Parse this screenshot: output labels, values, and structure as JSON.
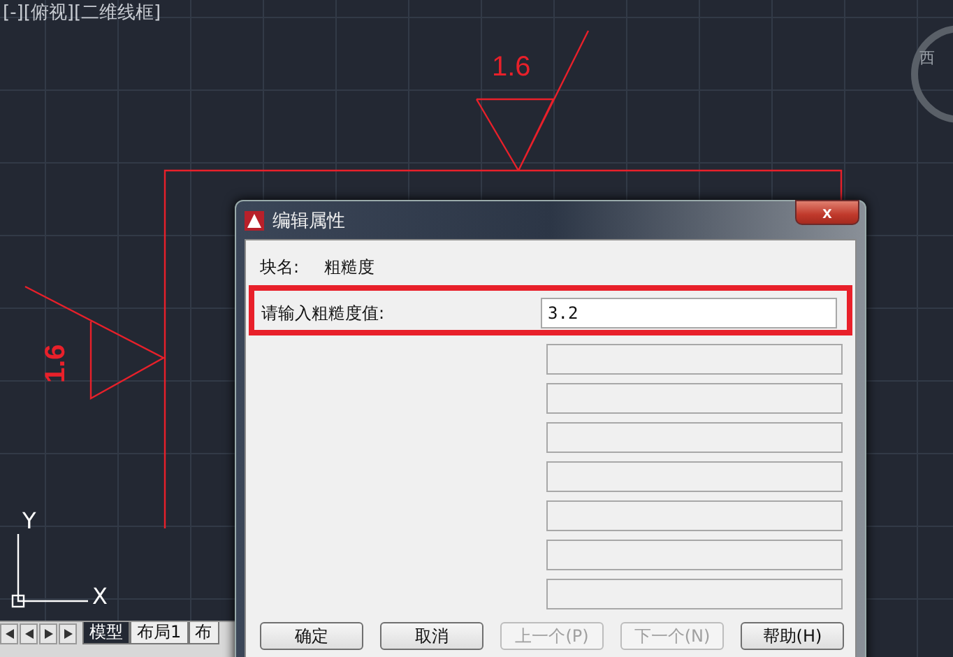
{
  "viewport_label": "[-][俯视][二维线框]",
  "compass_label": "西",
  "drawing": {
    "top_symbol_value": "1.6",
    "side_symbol_value": "1.6",
    "ucs_y": "Y",
    "ucs_x": "X"
  },
  "layout_tabs": [
    {
      "label": "模型",
      "selected": true
    },
    {
      "label": "布局1",
      "selected": false
    },
    {
      "label": "布",
      "selected": false
    }
  ],
  "dialog": {
    "title": "编辑属性",
    "close": "x",
    "block_name_label": "块名:",
    "block_name_value": "粗糙度",
    "fields": [
      {
        "label": "请输入粗糙度值:",
        "value": "3.2",
        "disabled": false,
        "highlighted": true
      },
      {
        "disabled": true,
        "highlighted": false
      },
      {
        "disabled": true,
        "highlighted": false
      },
      {
        "disabled": true,
        "highlighted": false
      },
      {
        "disabled": true,
        "highlighted": false
      },
      {
        "disabled": true,
        "highlighted": false
      },
      {
        "disabled": true,
        "highlighted": false
      },
      {
        "disabled": true,
        "highlighted": false
      }
    ],
    "buttons": [
      {
        "label": "确定",
        "disabled": false
      },
      {
        "label": "取消",
        "disabled": false
      },
      {
        "label": "上一个(P)",
        "disabled": true
      },
      {
        "label": "下一个(N)",
        "disabled": true
      },
      {
        "label": "帮助(H)",
        "disabled": false
      }
    ]
  }
}
